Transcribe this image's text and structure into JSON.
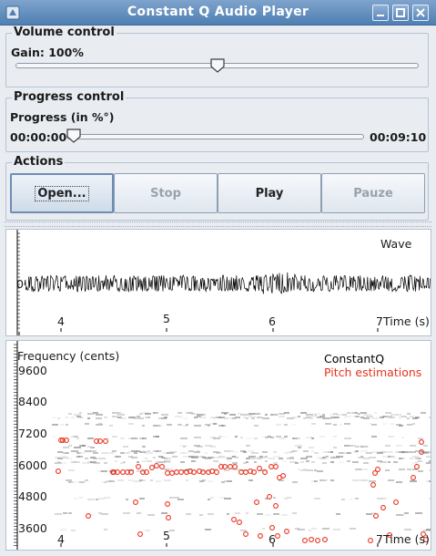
{
  "window": {
    "title": "Constant Q Audio Player"
  },
  "volume": {
    "group_title": "Volume control",
    "gain_label": "Gain: 100%",
    "slider_value": 0.5
  },
  "progress": {
    "group_title": "Progress control",
    "label": "Progress (in %°)",
    "current_time": "00:00:00",
    "total_time": "00:09:10",
    "slider_value": 0.0
  },
  "actions": {
    "group_title": "Actions",
    "buttons": [
      {
        "label": "Open...",
        "enabled": true,
        "focused": true
      },
      {
        "label": "Stop",
        "enabled": false
      },
      {
        "label": "Play",
        "enabled": true
      },
      {
        "label": "Pauze",
        "enabled": false
      }
    ]
  },
  "wave_panel": {
    "title": "Wave",
    "y_tick": "0",
    "x_ticks": [
      "4",
      "5",
      "6",
      "7"
    ],
    "x_axis_label": "Time (s)"
  },
  "cq_panel": {
    "y_axis_label": "Frequency (cents)",
    "y_ticks": [
      "9600",
      "8400",
      "7200",
      "6000",
      "4800",
      "3600"
    ],
    "x_ticks": [
      "4",
      "5",
      "6",
      "7"
    ],
    "x_axis_label": "Time (s)",
    "legend": [
      {
        "name": "ConstantQ",
        "color": "#000000"
      },
      {
        "name": "Pitch estimations",
        "color": "#e8321e"
      }
    ],
    "pitch_color": "#e8321e"
  }
}
